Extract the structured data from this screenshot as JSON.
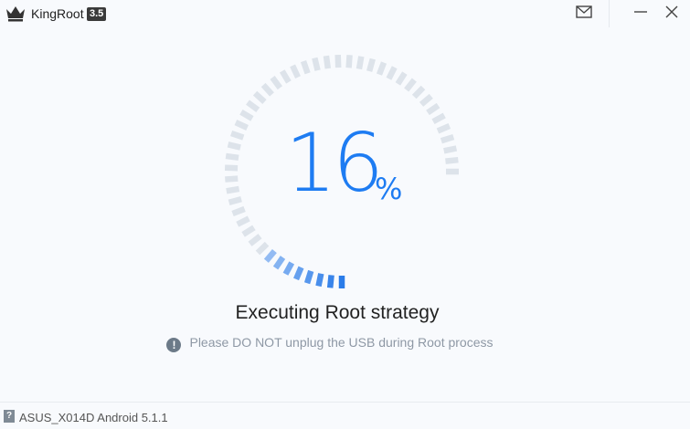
{
  "app": {
    "name": "KingRoot",
    "version": "3.5",
    "logo_icon": "crown-icon"
  },
  "titlebar": {
    "mail_icon": "mail-icon",
    "minimize_icon": "minimize-icon",
    "close_icon": "close-icon"
  },
  "progress": {
    "value": 16,
    "value_text": "16",
    "unit": "%",
    "fraction": 0.16,
    "active_color": "#2b7ce9",
    "track_color": "#dde3ea"
  },
  "status": {
    "title": "Executing Root strategy",
    "warning_icon": "exclamation-icon",
    "warning": "Please DO NOT unplug the USB during Root process"
  },
  "footer": {
    "help_icon": "question-icon",
    "help_label": "?",
    "device": "ASUS_X014D Android 5.1.1"
  },
  "colors": {
    "accent": "#1e7cf2",
    "background": "#f8fafd"
  }
}
